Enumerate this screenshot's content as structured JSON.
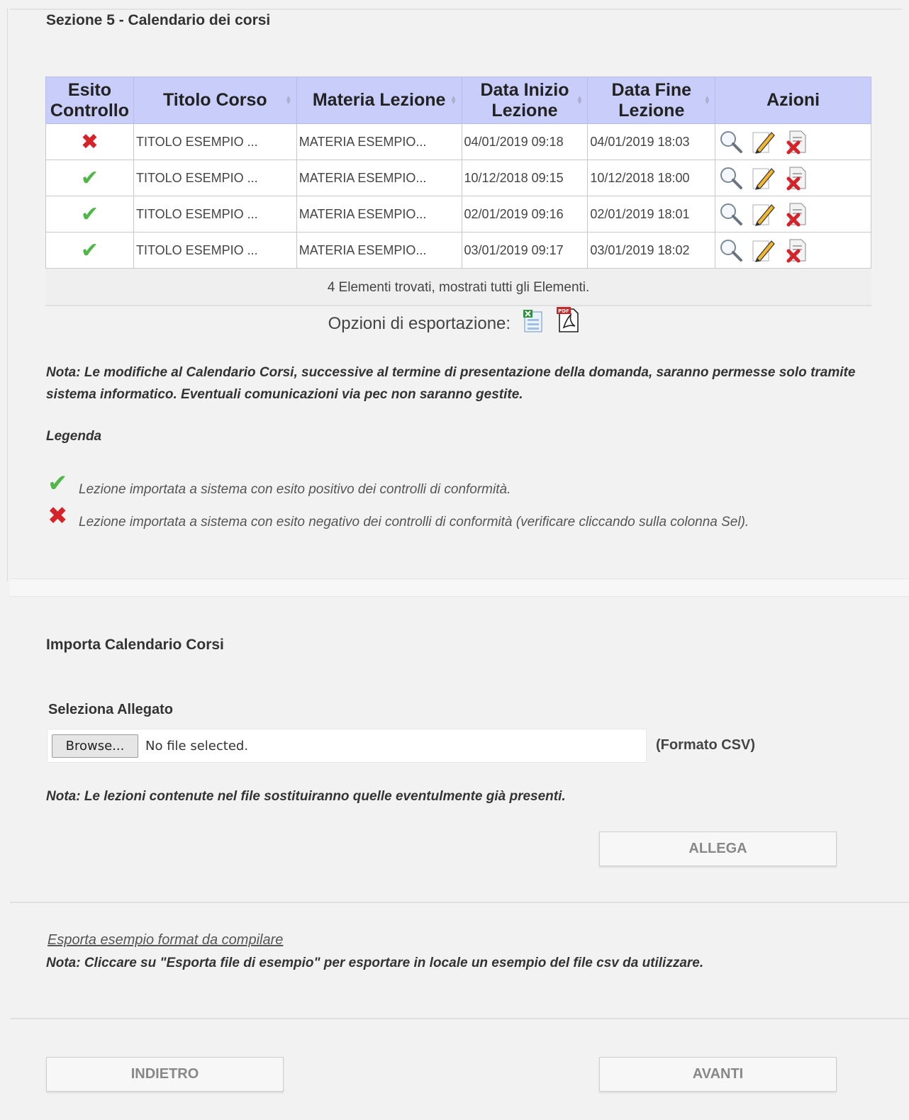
{
  "section5": {
    "title": "Sezione 5 - Calendario dei corsi",
    "table": {
      "headers": [
        "Esito Controllo",
        "Titolo Corso",
        "Materia Lezione",
        "Data Inizio Lezione",
        "Data Fine Lezione",
        "Azioni"
      ],
      "rows": [
        {
          "esito": "ko",
          "titolo": "TITOLO ESEMPIO ...",
          "materia": "MATERIA ESEMPIO...",
          "inizio": "04/01/2019 09:18",
          "fine": "04/01/2019 18:03"
        },
        {
          "esito": "ok",
          "titolo": "TITOLO ESEMPIO ...",
          "materia": "MATERIA ESEMPIO...",
          "inizio": "10/12/2018 09:15",
          "fine": "10/12/2018 18:00"
        },
        {
          "esito": "ok",
          "titolo": "TITOLO ESEMPIO ...",
          "materia": "MATERIA ESEMPIO...",
          "inizio": "02/01/2019 09:16",
          "fine": "02/01/2019 18:01"
        },
        {
          "esito": "ok",
          "titolo": "TITOLO ESEMPIO ...",
          "materia": "MATERIA ESEMPIO...",
          "inizio": "03/01/2019 09:17",
          "fine": "03/01/2019 18:02"
        }
      ],
      "action_icons": [
        "search-icon",
        "edit-icon",
        "delete-document-icon"
      ],
      "footer": "4 Elementi trovati, mostrati tutti gli Elementi."
    },
    "export_label": "Opzioni di esportazione:",
    "export_icons": [
      "excel-icon",
      "pdf-icon"
    ],
    "note": "Nota: Le modifiche al Calendario Corsi, successive al termine di presentazione della domanda, saranno permesse solo tramite sistema informatico. Eventuali comunicazioni via pec non saranno gestite.",
    "legend_title": "Legenda",
    "legend": {
      "ok": "Lezione importata a sistema con esito positivo dei controlli di conformità.",
      "ko": "Lezione importata a sistema con esito negativo dei controlli di conformità (verificare cliccando sulla colonna Sel)."
    }
  },
  "import": {
    "title": "Importa Calendario Corsi",
    "select_label": "Seleziona Allegato",
    "browse_label": "Browse...",
    "file_status": "No file selected.",
    "format_hint": "(Formato CSV)",
    "note": "Nota: Le lezioni contenute nel file sostituiranno quelle eventulmente già presenti.",
    "attach_button": "ALLEGA"
  },
  "sample": {
    "link": "Esporta esempio format da compilare",
    "note": "Nota: Cliccare su \"Esporta file di esempio\" per esportare in locale un esempio del file csv da utilizzare."
  },
  "nav": {
    "back": "INDIETRO",
    "next": "AVANTI"
  },
  "colors": {
    "header_bg": "#c9cdfa",
    "ok": "#4fb748",
    "ko": "#d6232a",
    "page_bg": "#f2f2f2"
  }
}
